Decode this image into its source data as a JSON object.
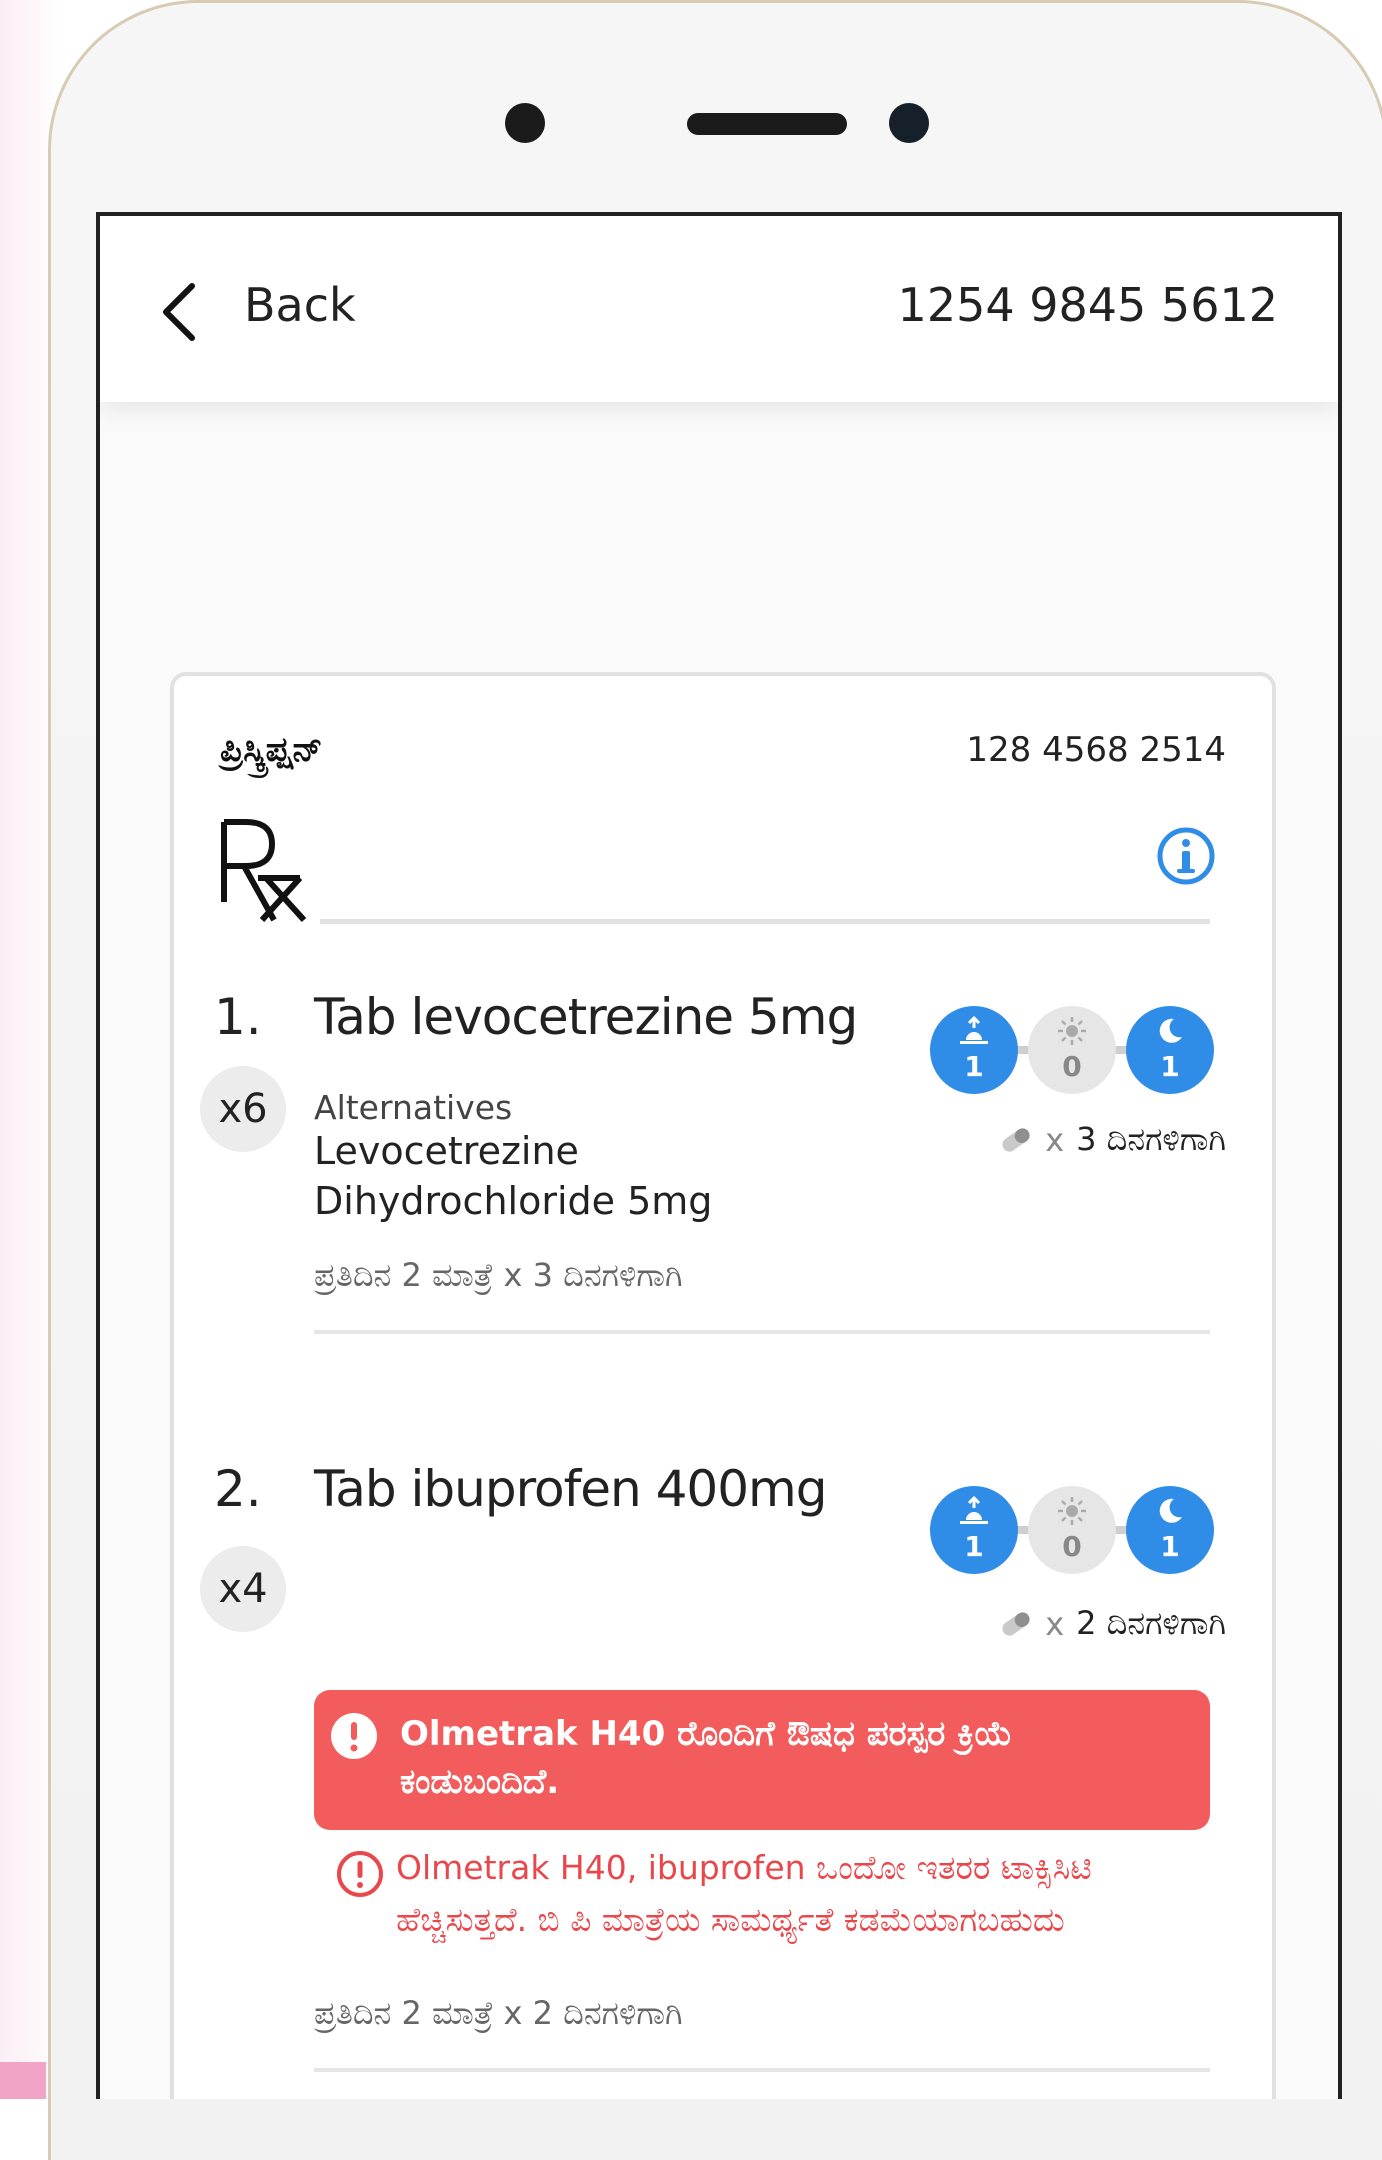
{
  "header": {
    "back_label": "Back",
    "patient_id": "1254 9845 5612"
  },
  "prescription": {
    "title": "ಪ್ರಿಸ್ಕ್ರಿಪ್ಷನ್",
    "id": "128 4568 2514",
    "medicines": [
      {
        "number": "1.",
        "name": "Tab levocetrezine 5mg",
        "quantity": "x6",
        "alternatives_label": "Alternatives",
        "alternative_name": "Levocetrezine Dihydrochloride 5mg",
        "schedule": {
          "morning": "1",
          "afternoon": "0",
          "night": "1"
        },
        "pill_times": "x",
        "pill_duration": "3 ದಿನಗಳಿಗಾಗಿ",
        "dosage_text": "ಪ್ರತಿದಿನ 2 ಮಾತ್ರೆ x 3 ದಿನಗಳಿಗಾಗಿ"
      },
      {
        "number": "2.",
        "name": "Tab ibuprofen 400mg",
        "quantity": "x4",
        "schedule": {
          "morning": "1",
          "afternoon": "0",
          "night": "1"
        },
        "pill_times": "x",
        "pill_duration": "2 ದಿನಗಳಿಗಾಗಿ",
        "alert": "Olmetrak H40 ರೊಂದಿಗೆ ಔಷಧ ಪರಸ್ಪರ ಕ್ರಿಯೆ ಕಂಡುಬಂದಿದೆ.",
        "warning": "Olmetrak H40, ibuprofen ಒಂದೋ ಇತರರ ಟಾಕ್ಸಿಸಿಟಿ ಹೆಚ್ಚಿಸುತ್ತದೆ. ಬಿ ಪಿ ಮಾತ್ರೆಯ ಸಾಮರ್ಥ್ಯತೆ ಕಡಮೆಯಾಗಬಹುದು",
        "dosage_text": "ಪ್ರತಿದಿನ 2 ಮಾತ್ರೆ x 2 ದಿನಗಳಿಗಾಗಿ"
      }
    ]
  },
  "colors": {
    "accent": "#2f8de8",
    "alert": "#f25c5c",
    "warning_text": "#e8484c"
  },
  "icons": {
    "back": "chevron-left-icon",
    "info": "info-icon",
    "morning": "sunrise-icon",
    "afternoon": "sun-icon",
    "night": "moon-icon",
    "pill": "pill-icon",
    "alert": "exclamation-circle-icon"
  }
}
